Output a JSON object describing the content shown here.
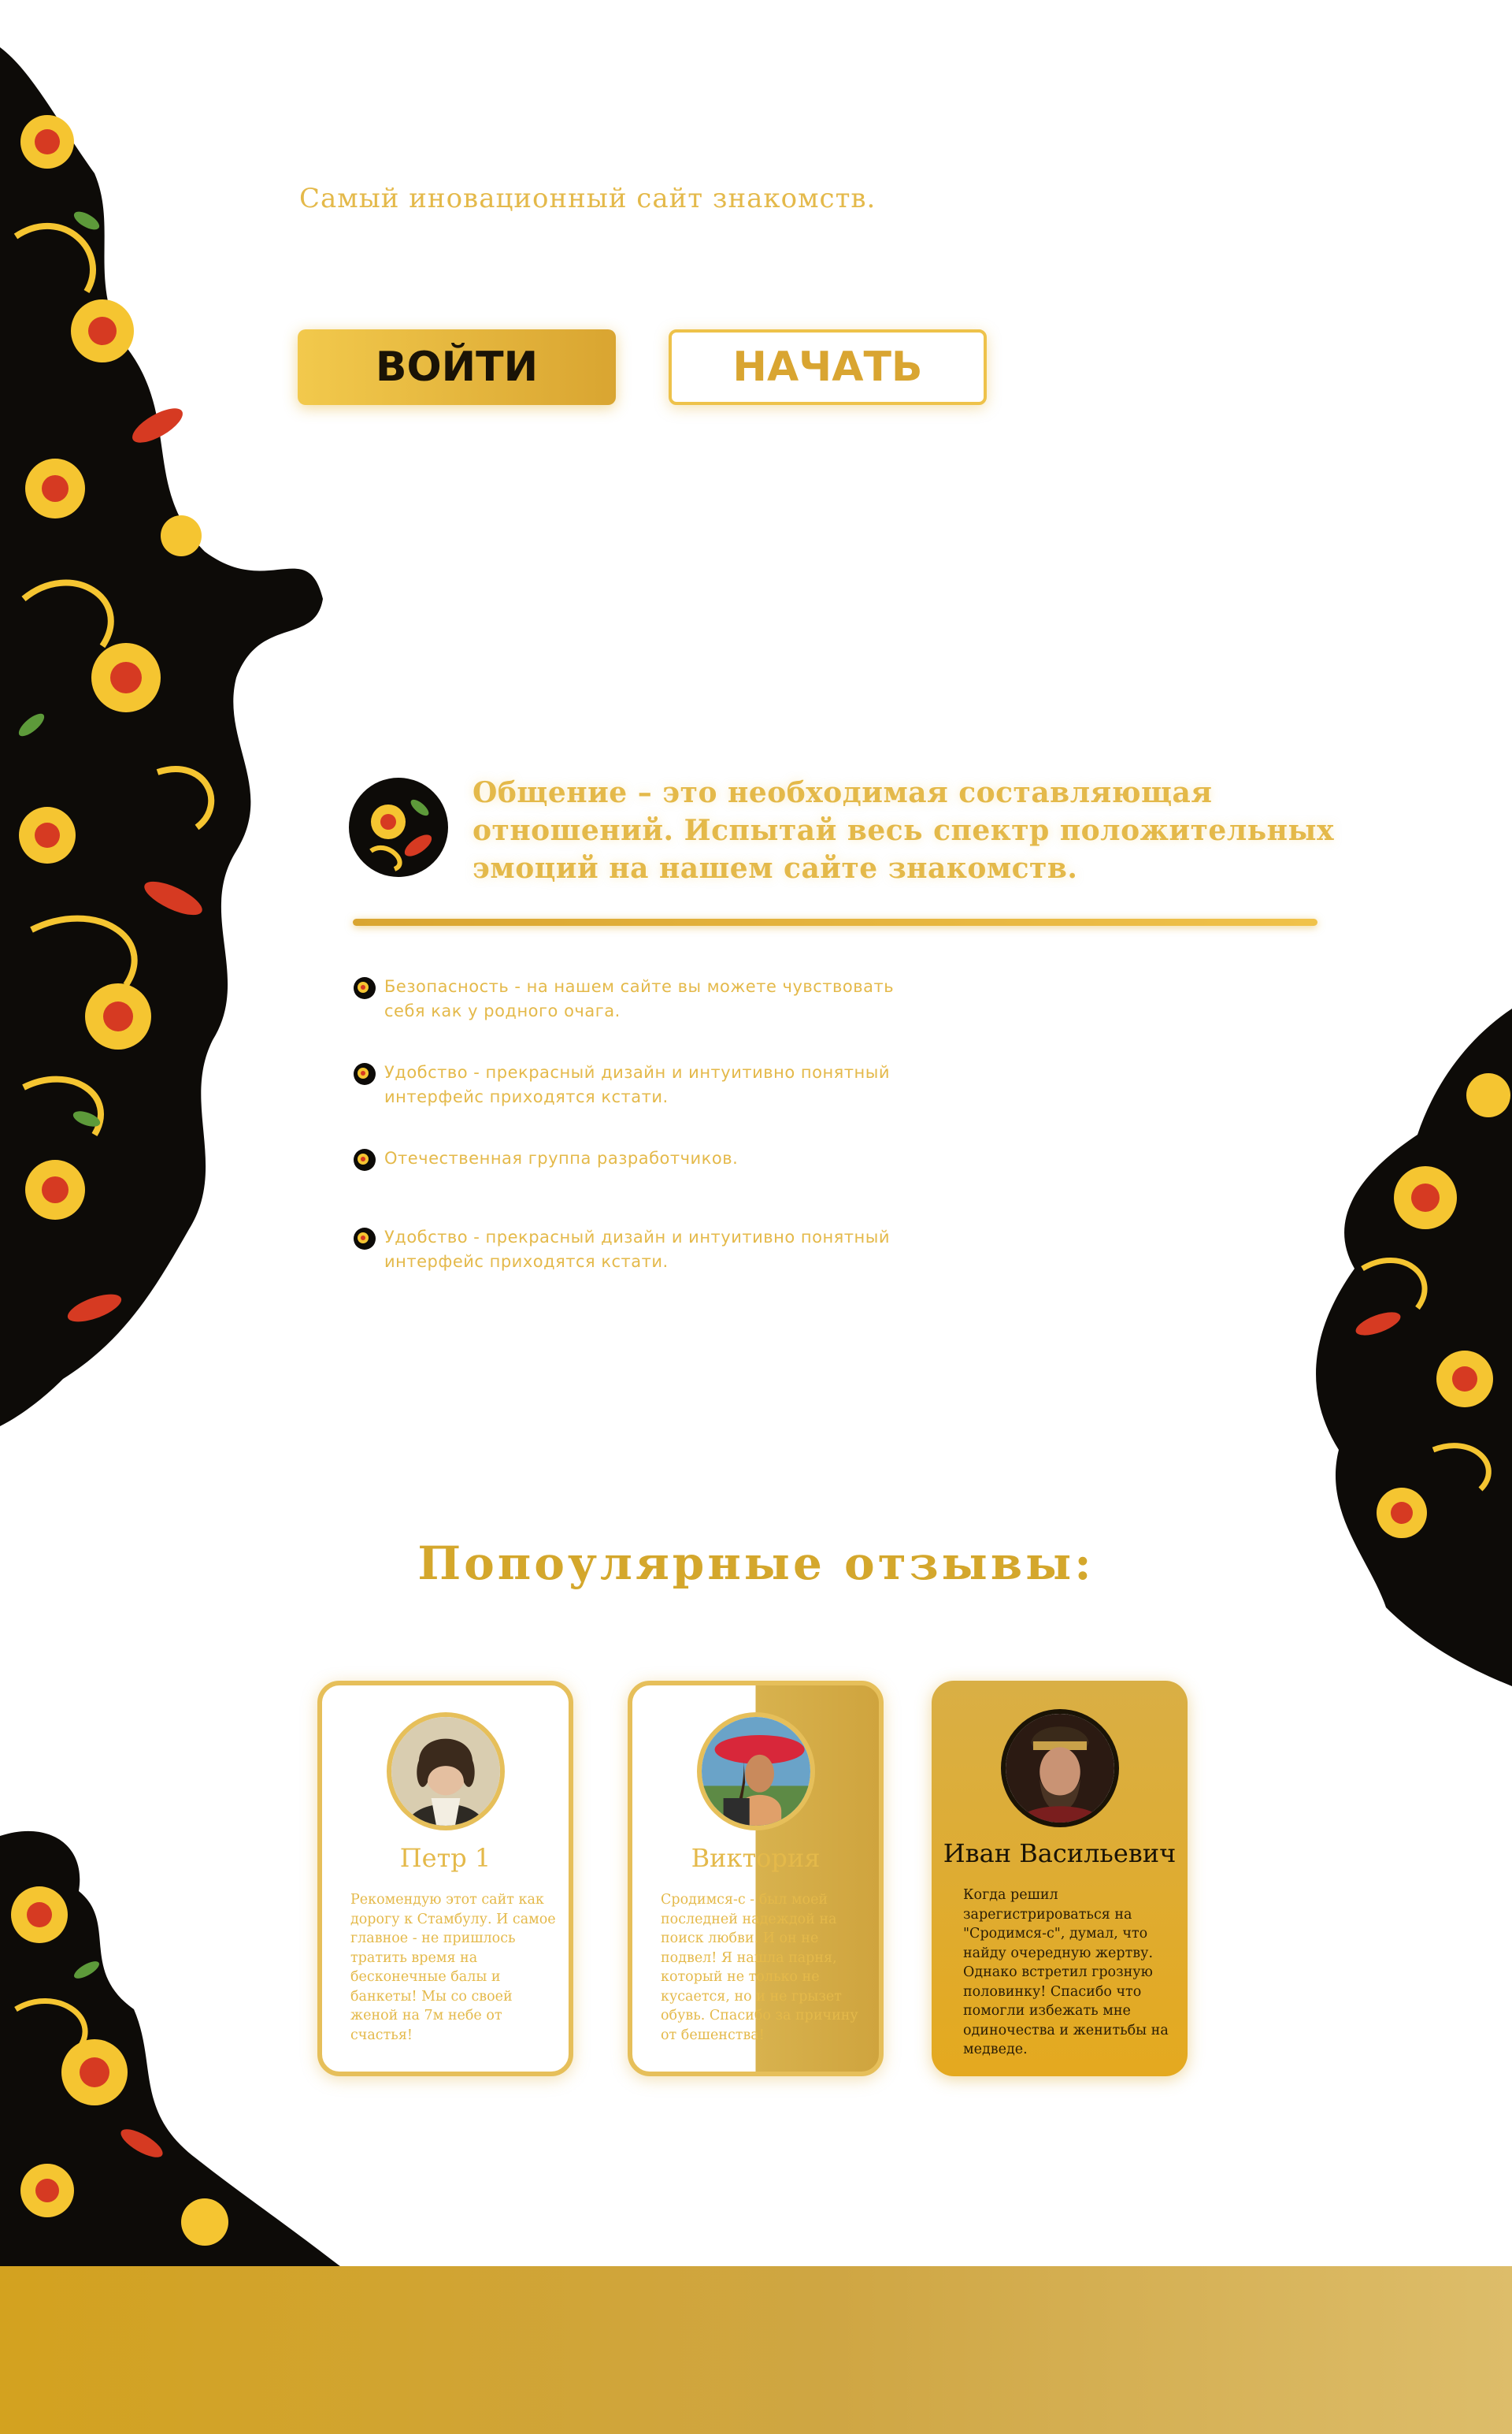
{
  "hero": {
    "tagline": "Самый иновационный сайт знакомств.",
    "login_label": "ВОЙТИ",
    "start_label": "НАЧАТЬ"
  },
  "features": {
    "heading": "Общение – это необходимая составляющая отношений. Испытай весь спектр положительных эмоций на нашем сайте знакомств.",
    "items": [
      {
        "text": "Безопасность - на нашем сайте вы можете чувствовать себя как у родного очага."
      },
      {
        "text": "Удобство - прекрасный дизайн и интуитивно понятный интерфейс приходятся кстати."
      },
      {
        "text": "Отечественная группа разработчиков."
      },
      {
        "text": "Удобство - прекрасный дизайн и интуитивно понятный интерфейс приходятся кстати."
      }
    ]
  },
  "reviews": {
    "title": "Попоулярные отзывы:",
    "cards": [
      {
        "name": "Петр 1",
        "text": "Рекомендую этот сайт как дорогу к Стамбулу. И самое главное - не пришлось тратить время на бесконечные балы и банкеты! Мы со своей женой на 7м небе от счастья!"
      },
      {
        "name": "Виктория",
        "text": "Сродимся-с - был моей последней надеждой на поиск любви. И он не подвел! Я нашла парня, который не только не кусается, но и не грызет обувь. Спасибо за причину от бешенства!"
      },
      {
        "name": "Иван Васильевич",
        "text": "Когда решил зарегистрироваться на \"Сродимся-с\", думал, что найду очередную жертву. Однако встретил грозную половинку! Спасибо что помогли избежать мне одиночества и женитьбы на медведе."
      }
    ]
  },
  "colors": {
    "gold": "#e4b94a",
    "gold_dark": "#d4a72c",
    "ink": "#1a1306",
    "ornament_black": "#0d0b08",
    "ornament_red": "#d63a22",
    "ornament_yellow": "#f5c531",
    "ornament_green": "#5d9a3a"
  },
  "icons": {
    "ornament": "khokhloma-ornament",
    "emblem": "khokhloma-emblem-icon",
    "bullet": "ornament-bullet-icon"
  }
}
